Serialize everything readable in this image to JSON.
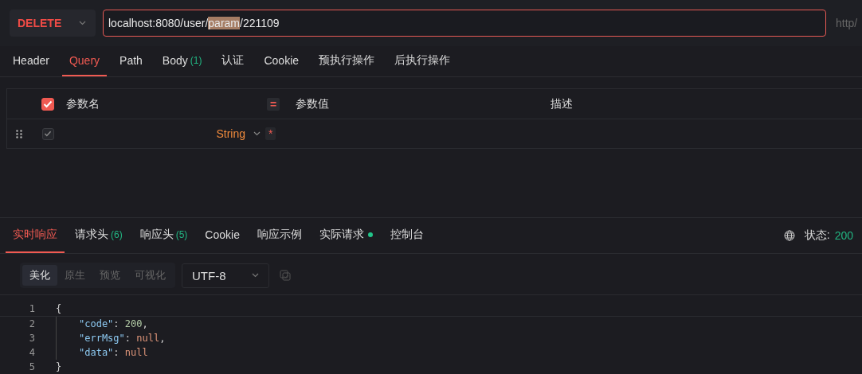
{
  "request": {
    "method": "DELETE",
    "url": {
      "before": "localhost:8080/user/",
      "highlighted": "param",
      "after": "/221109"
    },
    "side_text": "http/"
  },
  "request_tabs": [
    {
      "label": "Header",
      "selected": false
    },
    {
      "label": "Query",
      "selected": true
    },
    {
      "label": "Path",
      "selected": false
    },
    {
      "label": "Body",
      "count": "(1)",
      "selected": false
    },
    {
      "label": "认证",
      "selected": false
    },
    {
      "label": "Cookie",
      "selected": false
    },
    {
      "label": "预执行操作",
      "selected": false
    },
    {
      "label": "后执行操作",
      "selected": false
    }
  ],
  "params_table": {
    "all_checked": true,
    "columns": [
      "参数名",
      "=",
      "参数值",
      "描述"
    ],
    "rows": [
      {
        "checked": true,
        "type": "String",
        "required_mark": "*"
      }
    ]
  },
  "response_tabs": [
    {
      "label": "实时响应",
      "selected": true
    },
    {
      "label": "请求头",
      "count": "(6)",
      "selected": false
    },
    {
      "label": "响应头",
      "count": "(5)",
      "selected": false
    },
    {
      "label": "Cookie",
      "selected": false
    },
    {
      "label": "响应示例",
      "selected": false
    },
    {
      "label": "实际请求",
      "dot": true,
      "selected": false
    },
    {
      "label": "控制台",
      "selected": false
    }
  ],
  "status": {
    "label": "状态:",
    "code": "200"
  },
  "view_modes": [
    {
      "label": "美化",
      "selected": true
    },
    {
      "label": "原生",
      "selected": false
    },
    {
      "label": "预览",
      "selected": false
    },
    {
      "label": "可视化",
      "selected": false
    }
  ],
  "encoding": "UTF-8",
  "code_lines": [
    {
      "number": "1",
      "tokens": [
        {
          "kind": "punct",
          "text": "{"
        }
      ],
      "children": [
        {
          "number": "2",
          "tokens": [
            {
              "kind": "key",
              "text": "\"code\""
            },
            {
              "kind": "punct",
              "text": ": "
            },
            {
              "kind": "number",
              "text": "200"
            },
            {
              "kind": "punct",
              "text": ","
            }
          ]
        },
        {
          "number": "3",
          "tokens": [
            {
              "kind": "key",
              "text": "\"errMsg\""
            },
            {
              "kind": "punct",
              "text": ": "
            },
            {
              "kind": "null",
              "text": "null"
            },
            {
              "kind": "punct",
              "text": ","
            }
          ]
        },
        {
          "number": "4",
          "tokens": [
            {
              "kind": "key",
              "text": "\"data\""
            },
            {
              "kind": "punct",
              "text": ": "
            },
            {
              "kind": "null",
              "text": "null"
            }
          ]
        }
      ]
    },
    {
      "number": "5",
      "tokens": [
        {
          "kind": "punct",
          "text": "}"
        }
      ]
    }
  ]
}
